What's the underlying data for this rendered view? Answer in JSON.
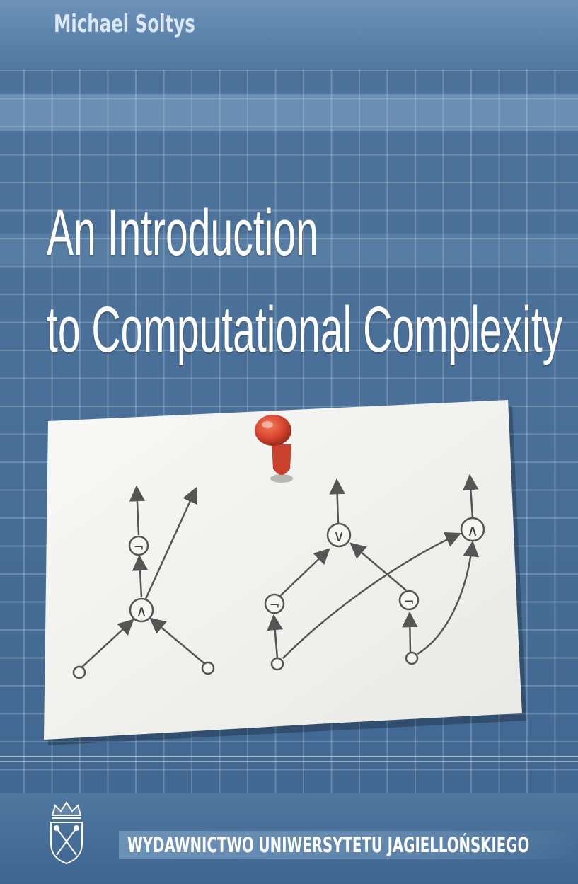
{
  "cover": {
    "author": "Michael Soltys",
    "title_line_1": "An Introduction",
    "title_line_2": "to Computational Complexity",
    "publisher": "WYDAWNICTWO UNIWERSYTETU JAGIELLOŃSKIEGO"
  },
  "diagram": {
    "and_symbol": "∧",
    "or_symbol": "∨",
    "not_symbol": "¬"
  },
  "colors": {
    "background": "#45698f",
    "title_text": "#ffffff",
    "author_text": "#dbe9f7",
    "pushpin": "#d8462f",
    "paper": "#f4f4f2"
  }
}
